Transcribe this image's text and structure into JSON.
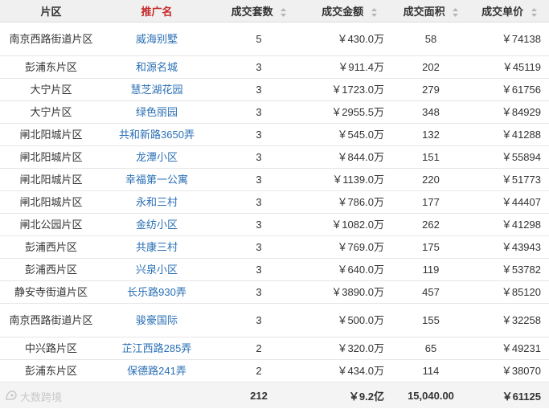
{
  "headers": {
    "area": "片区",
    "name": "推广名",
    "count": "成交套数",
    "amount": "成交金额",
    "size": "成交面积",
    "price": "成交单价"
  },
  "rows": [
    {
      "area": "南京西路街道片区",
      "name": "威海别墅",
      "count": "5",
      "amount": "￥430.0万",
      "size": "58",
      "price": "￥74138"
    },
    {
      "area": "彭浦东片区",
      "name": "和源名城",
      "count": "3",
      "amount": "￥911.4万",
      "size": "202",
      "price": "￥45119"
    },
    {
      "area": "大宁片区",
      "name": "慧芝湖花园",
      "count": "3",
      "amount": "￥1723.0万",
      "size": "279",
      "price": "￥61756"
    },
    {
      "area": "大宁片区",
      "name": "绿色丽园",
      "count": "3",
      "amount": "￥2955.5万",
      "size": "348",
      "price": "￥84929"
    },
    {
      "area": "闸北阳城片区",
      "name": "共和新路3650弄",
      "count": "3",
      "amount": "￥545.0万",
      "size": "132",
      "price": "￥41288"
    },
    {
      "area": "闸北阳城片区",
      "name": "龙潭小区",
      "count": "3",
      "amount": "￥844.0万",
      "size": "151",
      "price": "￥55894"
    },
    {
      "area": "闸北阳城片区",
      "name": "幸福第一公寓",
      "count": "3",
      "amount": "￥1139.0万",
      "size": "220",
      "price": "￥51773"
    },
    {
      "area": "闸北阳城片区",
      "name": "永和三村",
      "count": "3",
      "amount": "￥786.0万",
      "size": "177",
      "price": "￥44407"
    },
    {
      "area": "闸北公园片区",
      "name": "金纺小区",
      "count": "3",
      "amount": "￥1082.0万",
      "size": "262",
      "price": "￥41298"
    },
    {
      "area": "彭浦西片区",
      "name": "共康三村",
      "count": "3",
      "amount": "￥769.0万",
      "size": "175",
      "price": "￥43943"
    },
    {
      "area": "彭浦西片区",
      "name": "兴泉小区",
      "count": "3",
      "amount": "￥640.0万",
      "size": "119",
      "price": "￥53782"
    },
    {
      "area": "静安寺街道片区",
      "name": "长乐路930弄",
      "count": "3",
      "amount": "￥3890.0万",
      "size": "457",
      "price": "￥85120"
    },
    {
      "area": "南京西路街道片区",
      "name": "骏豪国际",
      "count": "3",
      "amount": "￥500.0万",
      "size": "155",
      "price": "￥32258"
    },
    {
      "area": "中兴路片区",
      "name": "芷江西路285弄",
      "count": "2",
      "amount": "￥320.0万",
      "size": "65",
      "price": "￥49231"
    },
    {
      "area": "彭浦东片区",
      "name": "保德路241弄",
      "count": "2",
      "amount": "￥434.0万",
      "size": "114",
      "price": "￥38070"
    }
  ],
  "footer": {
    "count": "212",
    "amount": "￥9.2亿",
    "size": "15,040.00",
    "price": "￥61125"
  },
  "watermark": {
    "text": "大数跨境"
  },
  "colors": {
    "header_bg": "#f0f0f0",
    "link": "#2a6fb5",
    "accent_header": "#c62828",
    "footer_bg": "#f4f4f4"
  },
  "icons": {
    "sort": "sort-arrows-icon"
  }
}
